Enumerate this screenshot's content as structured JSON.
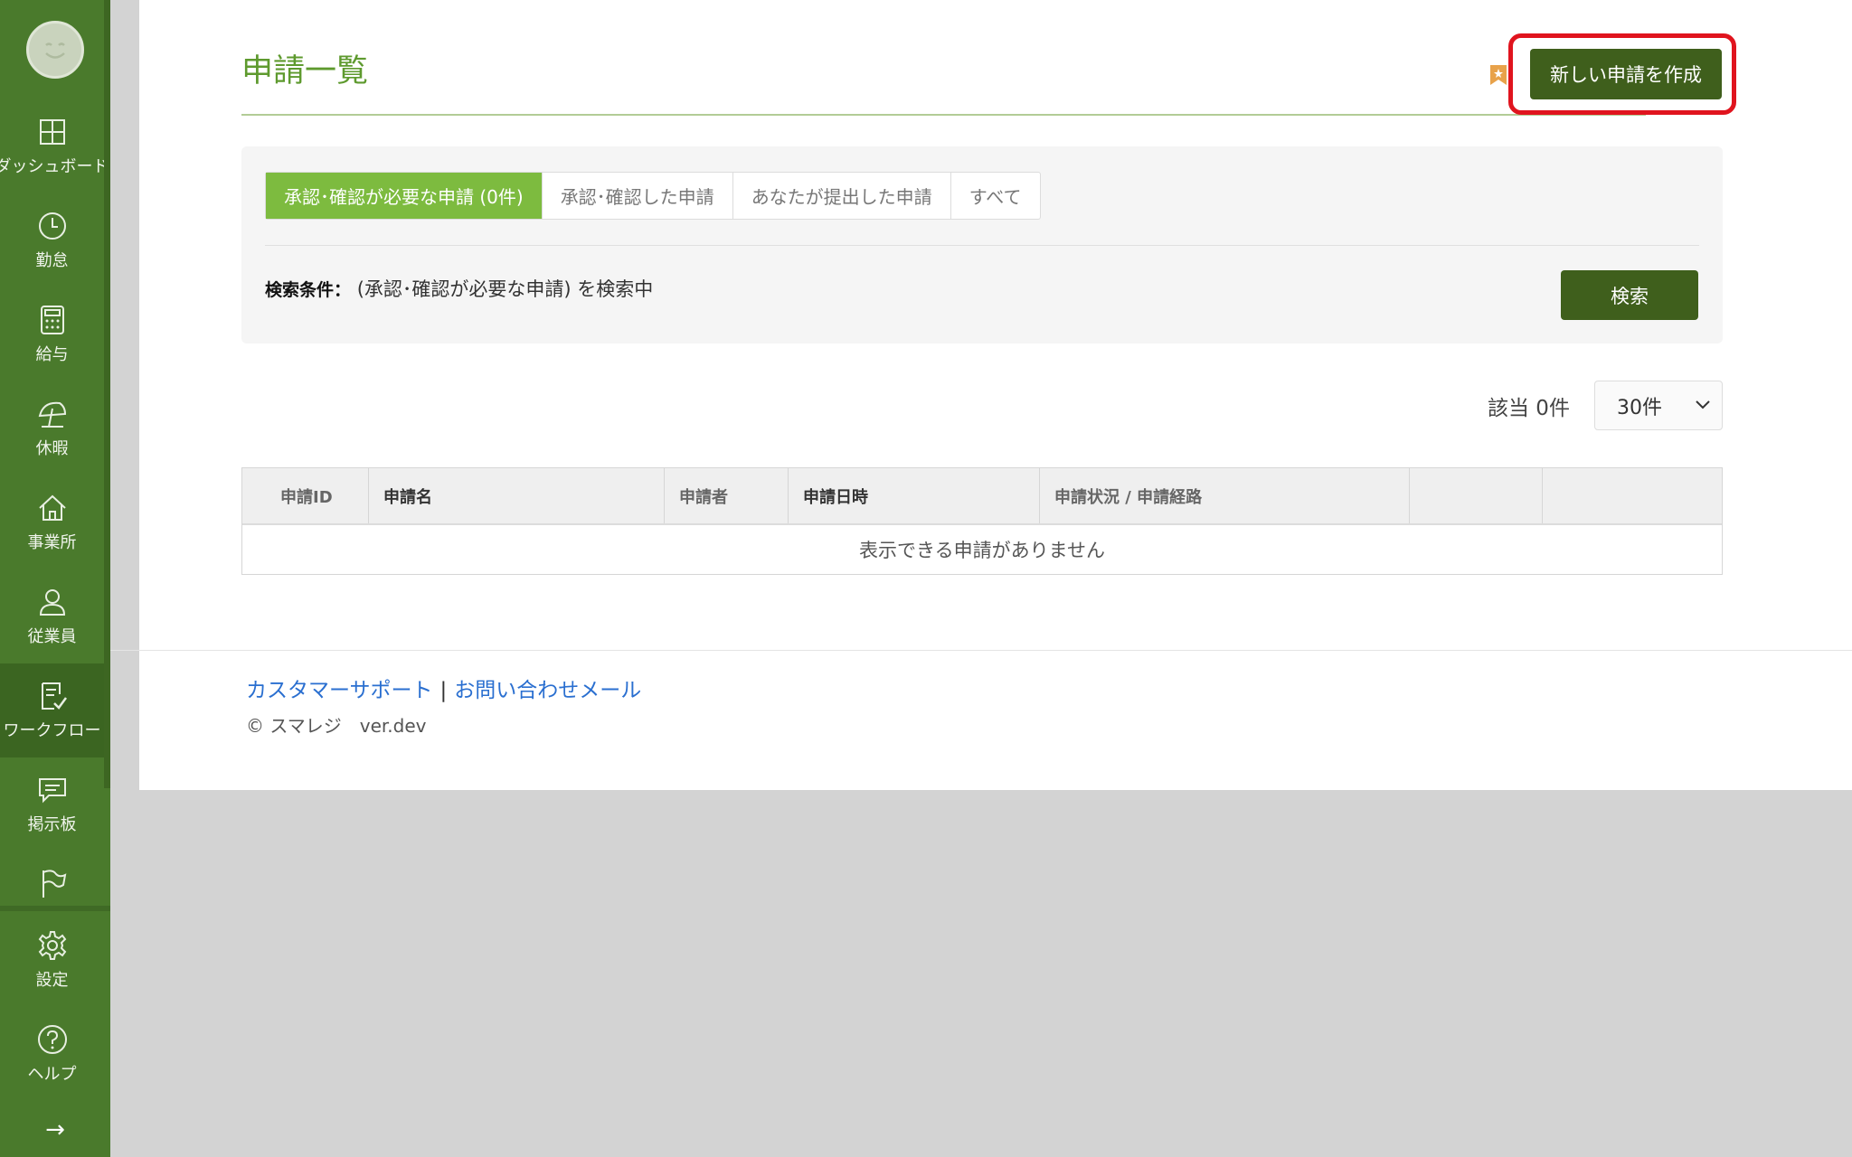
{
  "sidebar": {
    "items": [
      {
        "label": "ダッシュボード",
        "icon": "dashboard-icon"
      },
      {
        "label": "勤怠",
        "icon": "clock-icon"
      },
      {
        "label": "給与",
        "icon": "calculator-icon"
      },
      {
        "label": "休暇",
        "icon": "umbrella-icon"
      },
      {
        "label": "事業所",
        "icon": "home-icon"
      },
      {
        "label": "従業員",
        "icon": "person-icon"
      },
      {
        "label": "ワークフロー",
        "icon": "workflow-icon",
        "active": true
      },
      {
        "label": "掲示板",
        "icon": "chat-icon"
      }
    ],
    "bottom": [
      {
        "label": "設定",
        "icon": "gear-icon"
      },
      {
        "label": "ヘルプ",
        "icon": "help-icon"
      }
    ],
    "expand_icon": "→"
  },
  "header": {
    "title": "申請一覧",
    "new_button": "新しい申請を作成"
  },
  "filter": {
    "tabs": [
      {
        "label": "承認･確認が必要な申請 (0件)",
        "active": true
      },
      {
        "label": "承認･確認した申請"
      },
      {
        "label": "あなたが提出した申請"
      },
      {
        "label": "すべて"
      }
    ],
    "condition_label": "検索条件：",
    "condition_value": "(承認･確認が必要な申請) を検索中",
    "search_button": "検索"
  },
  "results": {
    "count": "該当 0件",
    "per_page": "30件"
  },
  "table": {
    "columns": [
      "申請ID",
      "申請名",
      "申請者",
      "申請日時",
      "申請状況 / 申請経路",
      "",
      ""
    ],
    "empty_message": "表示できる申請がありません"
  },
  "footer": {
    "support_link": "カスタマーサポート",
    "separator": "|",
    "contact_link": "お問い合わせメール",
    "copyright": "© スマレジ　ver.dev"
  },
  "colors": {
    "sidebar": "#4a7a2c",
    "accent": "#7dbb3f",
    "button": "#3f5f1c",
    "highlight": "#e0141e"
  }
}
